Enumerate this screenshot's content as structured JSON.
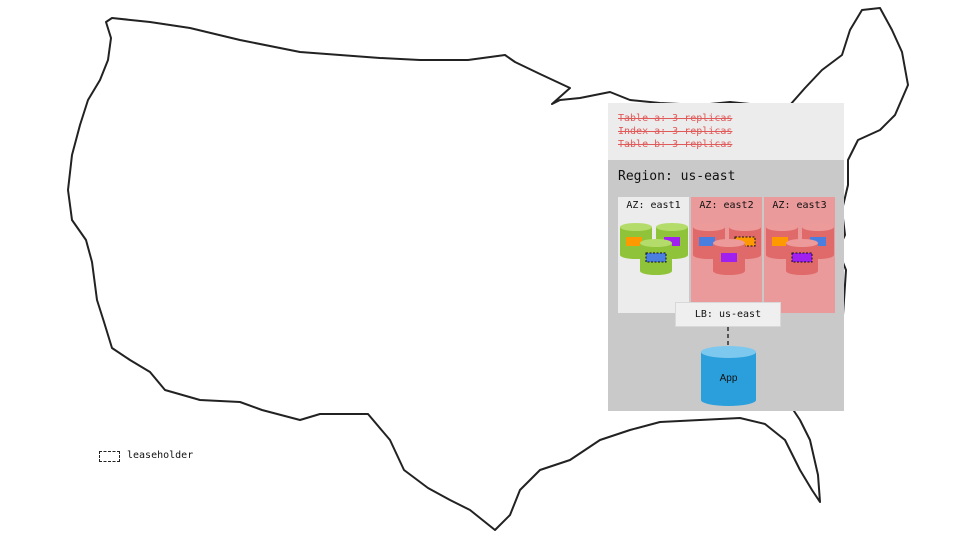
{
  "notes": [
    "Table a: 3 replicas",
    "Index a: 3 replicas",
    "Table b: 3 replicas"
  ],
  "region": {
    "title": "Region: us-east"
  },
  "zones": [
    {
      "label": "AZ: east1",
      "status": "available"
    },
    {
      "label": "AZ: east2",
      "status": "unavailable"
    },
    {
      "label": "AZ: east3",
      "status": "unavailable"
    }
  ],
  "load_balancer": {
    "label": "LB: us-east"
  },
  "app": {
    "label": "App"
  },
  "legend": {
    "label": "leaseholder"
  },
  "colors": {
    "region_bg": "#c9c9c9",
    "notes_bg": "#ececec",
    "note_text": "#e05a5a",
    "available_zone": "#ececec",
    "unavailable_zone": "#ea9a9a",
    "healthy_node": "#8fc43a",
    "failed_node": "#e06a6a",
    "app": "#2a9fdc",
    "range_orange": "#ff9900",
    "range_purple": "#a020f0",
    "range_blue": "#4a7fe0"
  }
}
